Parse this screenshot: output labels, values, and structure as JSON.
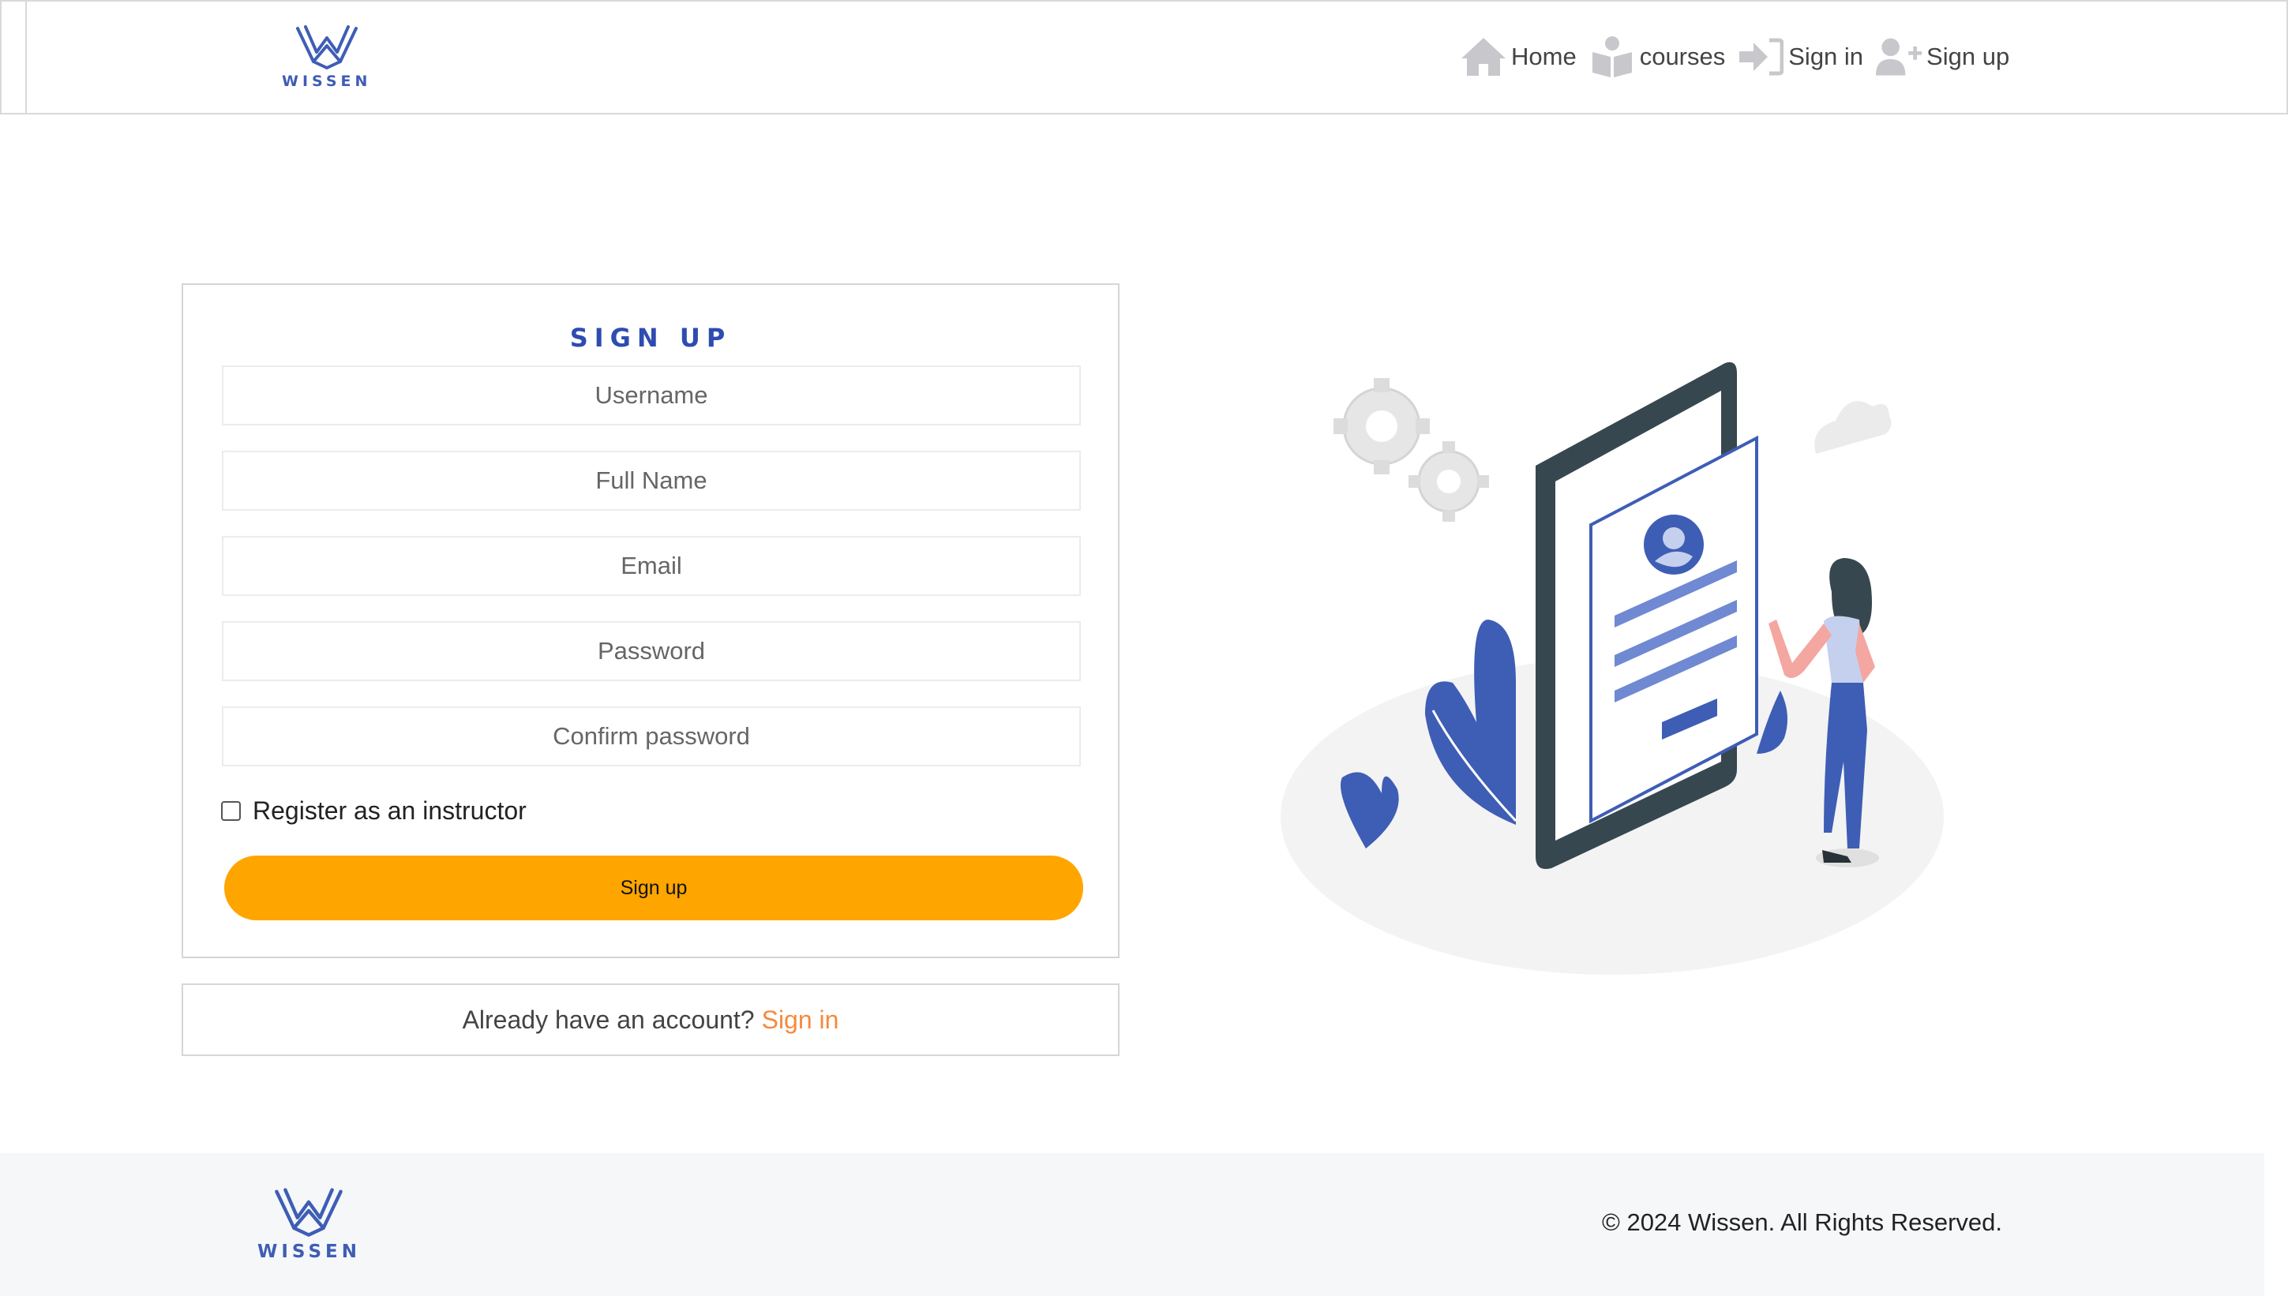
{
  "brand": {
    "name": "WISSEN",
    "color": "#3e5db5"
  },
  "nav": {
    "items": [
      {
        "label": "Home",
        "icon": "home-icon"
      },
      {
        "label": "courses",
        "icon": "book-reader-icon"
      },
      {
        "label": "Sign in",
        "icon": "sign-in-icon"
      },
      {
        "label": "Sign up",
        "icon": "user-plus-icon"
      }
    ]
  },
  "form": {
    "title": "SIGN UP",
    "fields": {
      "username": {
        "placeholder": "Username"
      },
      "fullname": {
        "placeholder": "Full Name"
      },
      "email": {
        "placeholder": "Email"
      },
      "password": {
        "placeholder": "Password"
      },
      "confirm": {
        "placeholder": "Confirm password"
      }
    },
    "instructor_checkbox": {
      "label": "Register as an instructor",
      "checked": false
    },
    "submit_label": "Sign up",
    "submit_color": "#ffa500"
  },
  "signin_prompt": {
    "text": "Already have an account?",
    "link": "Sign in",
    "link_color": "#f58a3c"
  },
  "footer": {
    "copyright": "© 2024 Wissen. All Rights Reserved."
  }
}
